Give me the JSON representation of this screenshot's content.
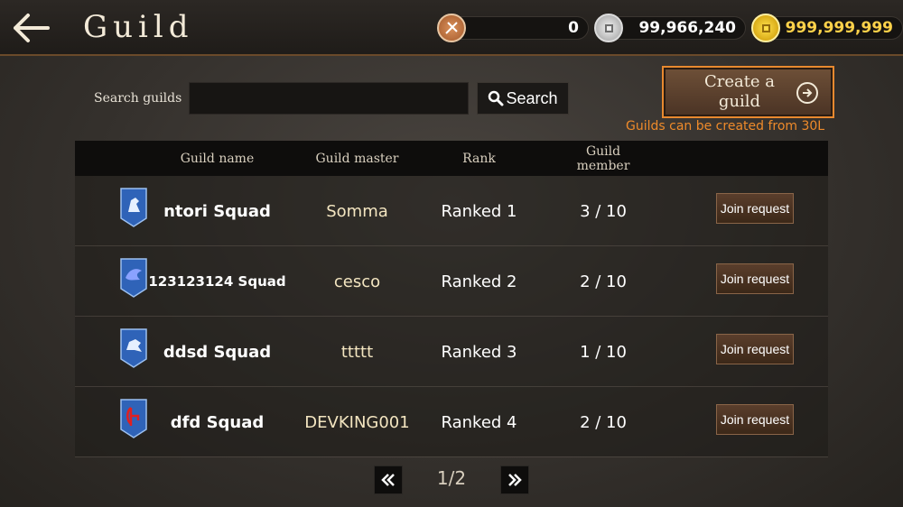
{
  "header": {
    "title": "Guild",
    "currencies": [
      {
        "icon": "sword-coin-icon",
        "value": "0"
      },
      {
        "icon": "silver-coin-icon",
        "value": "99,966,240"
      },
      {
        "icon": "gold-coin-icon",
        "value": "999,999,999",
        "color": "#ffd24a"
      }
    ]
  },
  "search": {
    "label": "Search guilds",
    "value": "",
    "placeholder": "",
    "button_label": "Search"
  },
  "create": {
    "line1": "Create a",
    "line2": "guild",
    "note": "Guilds can be created from 30L",
    "note_color": "#ee8a2a"
  },
  "table": {
    "columns": {
      "name": "Guild name",
      "master": "Guild master",
      "rank": "Rank",
      "member_line1": "Guild",
      "member_line2": "member"
    },
    "rows": [
      {
        "name": "ntori Squad",
        "master": "Somma",
        "rank": "Ranked 1",
        "members": "3 / 10",
        "action": "Join request",
        "emblem": "knight-emblem-icon"
      },
      {
        "name": "123123124 Squad",
        "master": "cesco",
        "rank": "Ranked 2",
        "members": "2 / 10",
        "action": "Join request",
        "emblem": "dragon-emblem-icon"
      },
      {
        "name": "ddsd Squad",
        "master": "ttttt",
        "rank": "Ranked 3",
        "members": "1 / 10",
        "action": "Join request",
        "emblem": "horse-emblem-icon"
      },
      {
        "name": "dfd Squad",
        "master": "DEVKING001",
        "rank": "Ranked 4",
        "members": "2 / 10",
        "action": "Join request",
        "emblem": "red-symbol-emblem-icon"
      }
    ]
  },
  "pagination": {
    "text": "1/2"
  }
}
